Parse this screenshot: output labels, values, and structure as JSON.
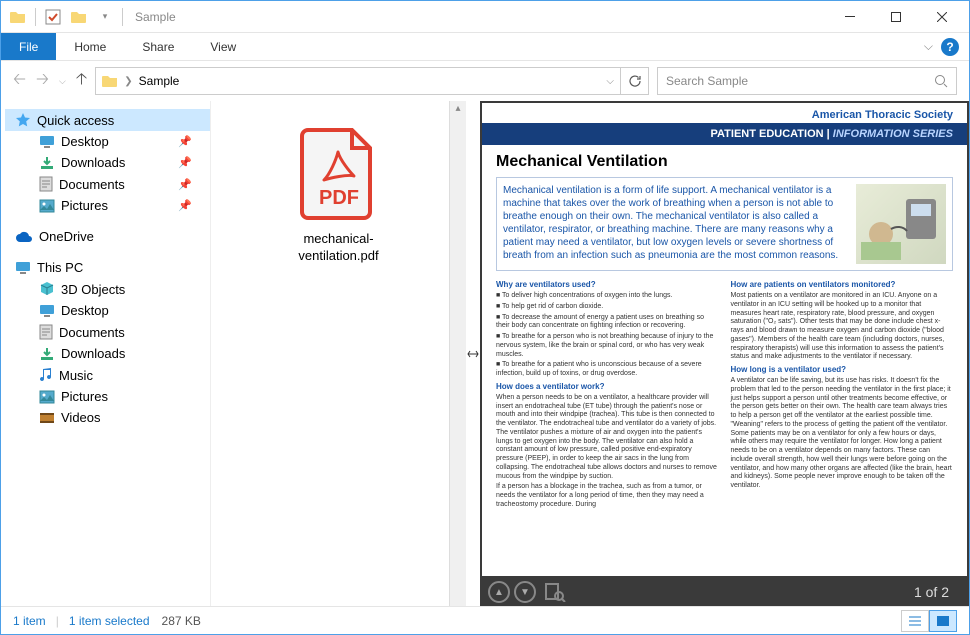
{
  "titlebar": {
    "title": "Sample"
  },
  "ribbon": {
    "file": "File",
    "home": "Home",
    "share": "Share",
    "view": "View"
  },
  "address": {
    "crumb": "Sample"
  },
  "search": {
    "placeholder": "Search Sample"
  },
  "nav": {
    "quick_access": "Quick access",
    "desktop": "Desktop",
    "downloads": "Downloads",
    "documents": "Documents",
    "pictures": "Pictures",
    "onedrive": "OneDrive",
    "this_pc": "This PC",
    "objects_3d": "3D Objects",
    "desktop2": "Desktop",
    "documents2": "Documents",
    "downloads2": "Downloads",
    "music": "Music",
    "pictures2": "Pictures",
    "videos": "Videos"
  },
  "file": {
    "name": "mechanical-ventilation.pdf",
    "badge": "PDF"
  },
  "preview": {
    "society": "American Thoracic Society",
    "band_left": "PATIENT EDUCATION",
    "band_sep": " | ",
    "band_right": "INFORMATION SERIES",
    "title": "Mechanical Ventilation",
    "intro": "Mechanical ventilation is a form of life support. A mechanical ventilator is a machine that takes over the work of breathing when a person is not able to breathe enough on their own. The mechanical ventilator is also called a ventilator, respirator, or breathing machine. There are many reasons why a patient may need a ventilator, but low oxygen levels or severe shortness of breath from an infection such as pneumonia are the most common reasons.",
    "col1_h1": "Why are ventilators used?",
    "col1_b1": "■ To deliver high concentrations of oxygen into the lungs.",
    "col1_b2": "■ To help get rid of carbon dioxide.",
    "col1_b3": "■ To decrease the amount of energy a patient uses on breathing so their body can concentrate on fighting infection or recovering.",
    "col1_b4": "■ To breathe for a person who is not breathing because of injury to the nervous system, like the brain or spinal cord, or who has very weak muscles.",
    "col1_b5": "■ To breathe for a patient who is unconscious because of a severe infection, build up of toxins, or drug overdose.",
    "col1_h2": "How does a ventilator work?",
    "col1_p1": "When a person needs to be on a ventilator, a healthcare provider will insert an endotracheal tube (ET tube) through the patient's nose or mouth and into their windpipe (trachea). This tube is then connected to the ventilator. The endotracheal tube and ventilator do a variety of jobs. The ventilator pushes a mixture of air and oxygen into the patient's lungs to get oxygen into the body. The ventilator can also hold a constant amount of low pressure, called positive end-expiratory pressure (PEEP), in order to keep the air sacs in the lung from collapsing. The endotracheal tube allows doctors and nurses to remove mucous from the windpipe by suction.",
    "col1_p2": "If a person has a blockage in the trachea, such as from a tumor, or needs the ventilator for a long period of time, then they may need a tracheostomy procedure. During",
    "col2_h1": "How are patients on ventilators monitored?",
    "col2_p1": "Most patients on a ventilator are monitored in an ICU. Anyone on a ventilator in an ICU setting will be hooked up to a monitor that measures heart rate, respiratory rate, blood pressure, and oxygen saturation (\"O₂ sats\"). Other tests that may be done include chest x-rays and blood drawn to measure oxygen and carbon dioxide (\"blood gases\"). Members of the health care team (including doctors, nurses, respiratory therapists) will use this information to assess the patient's status and make adjustments to the ventilator if necessary.",
    "col2_h2": "How long is a ventilator used?",
    "col2_p2": "A ventilator can be life saving, but its use has risks. It doesn't fix the problem that led to the person needing the ventilator in the first place; it just helps support a person until other treatments become effective, or the person gets better on their own. The health care team always tries to help a person get off the ventilator at the earliest possible time. \"Weaning\" refers to the process of getting the patient off the ventilator. Some patients may be on a ventilator for only a few hours or days, while others may require the ventilator for longer. How long a patient needs to be on a ventilator depends on many factors. These can include overall strength, how well their lungs were before going on the ventilator, and how many other organs are affected (like the brain, heart and kidneys). Some people never improve enough to be taken off the ventilator.",
    "page_indicator": "1 of 2"
  },
  "status": {
    "count": "1 item",
    "selected": "1 item selected",
    "size": "287 KB"
  }
}
